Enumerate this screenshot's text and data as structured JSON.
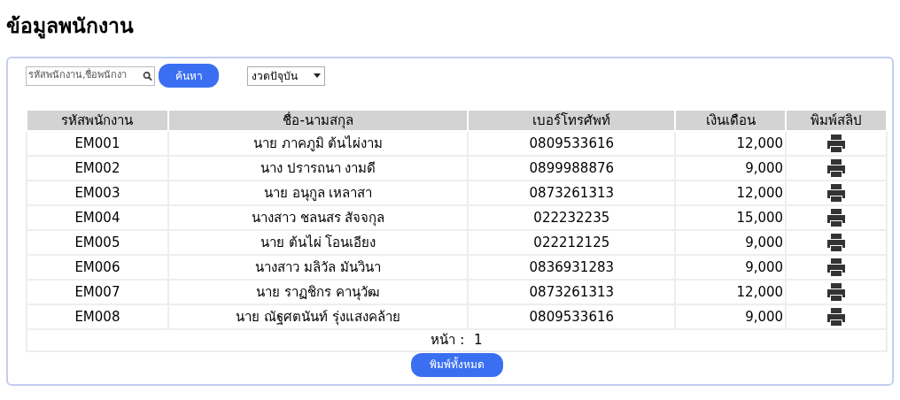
{
  "page_title": "ข้อมูลพนักงาน",
  "search": {
    "placeholder": "รหัสพนักงาน,ชื่อพนักงา",
    "button": "ค้นหา"
  },
  "period_select": {
    "value": "งวดปัจุบัน"
  },
  "table": {
    "columns": [
      "รหัสพนักงาน",
      "ชื่อ-นามสกุล",
      "เบอร์โทรศัพท์",
      "เงินเดือน",
      "พิมพ์สลิป"
    ],
    "rows": [
      {
        "id": "EM001",
        "name": "นาย ภาคภูมิ ต้นไผ่งาม",
        "phone": "0809533616",
        "salary": "12,000"
      },
      {
        "id": "EM002",
        "name": "นาง ปรารถนา งามดี",
        "phone": "0899988876",
        "salary": "9,000"
      },
      {
        "id": "EM003",
        "name": "นาย อนุกูล เหลาสา",
        "phone": "0873261313",
        "salary": "12,000"
      },
      {
        "id": "EM004",
        "name": "นางสาว ชลนสร สัจจกุล",
        "phone": "022232235",
        "salary": "15,000"
      },
      {
        "id": "EM005",
        "name": "นาย ต้นไผ่ โอนเอียง",
        "phone": "022212125",
        "salary": "9,000"
      },
      {
        "id": "EM006",
        "name": "นางสาว มลิวัล มันวินา",
        "phone": "0836931283",
        "salary": "9,000"
      },
      {
        "id": "EM007",
        "name": "นาย ราฏชิกร คานุวัฒ",
        "phone": "0873261313",
        "salary": "12,000"
      },
      {
        "id": "EM008",
        "name": "นาย ณัฐศตนันท์ รุ่งแสงคล้าย",
        "phone": "0809533616",
        "salary": "9,000"
      }
    ]
  },
  "pagination": {
    "label": "หน้า :",
    "page": "1"
  },
  "print_all_button": "พิมพ์ทั้งหมด"
}
